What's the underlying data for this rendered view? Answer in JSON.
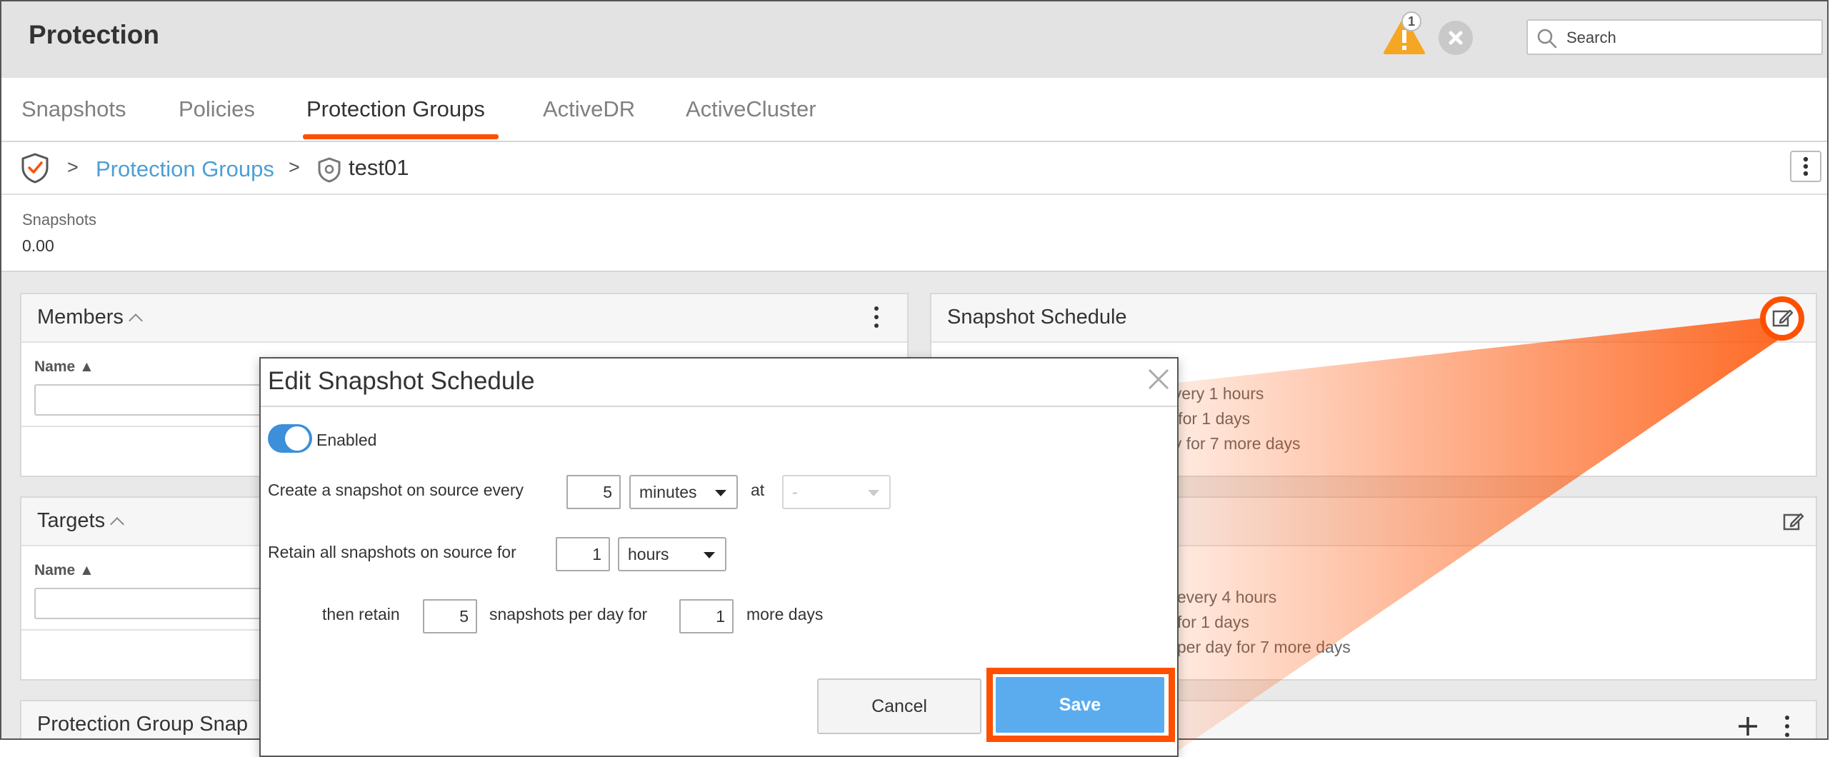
{
  "header": {
    "title": "Protection",
    "alert_count": "1",
    "search_placeholder": "Search"
  },
  "tabs": [
    {
      "label": "Snapshots"
    },
    {
      "label": "Policies"
    },
    {
      "label": "Protection Groups",
      "active": true
    },
    {
      "label": "ActiveDR"
    },
    {
      "label": "ActiveCluster"
    }
  ],
  "breadcrumb": {
    "separator": ">",
    "parent": "Protection Groups",
    "current": "test01"
  },
  "stats": {
    "label": "Snapshots",
    "value": "0.00"
  },
  "members_panel": {
    "title": "Members",
    "column": "Name"
  },
  "targets_panel": {
    "title": "Targets",
    "column": "Name"
  },
  "pg_snapshots_panel": {
    "title": "Protection Group Snap"
  },
  "snapshot_schedule_panel": {
    "title": "Snapshot Schedule",
    "lines": [
      "every 1 hours",
      "e for 1 days",
      "ay for 7 more days"
    ]
  },
  "replication_schedule_panel": {
    "lines": [
      "s every 4 hours",
      "s for 1 days",
      "s per day for 7 more days"
    ]
  },
  "modal": {
    "title": "Edit Snapshot Schedule",
    "enabled_label": "Enabled",
    "create_prefix": "Create a snapshot on source every",
    "create_value": "5",
    "create_unit": "minutes",
    "at_label": "at",
    "at_value": "-",
    "retain_prefix": "Retain all snapshots on source for",
    "retain_value": "1",
    "retain_unit": "hours",
    "then_retain_label": "then retain",
    "then_retain_value": "5",
    "per_day_label": "snapshots per day for",
    "days_value": "1",
    "more_days_label": "more days",
    "cancel_label": "Cancel",
    "save_label": "Save"
  },
  "colors": {
    "accent": "#fe5000",
    "link": "#4c9fd6",
    "primary_button": "#5aacef",
    "toggle_on": "#3c8fd8",
    "warning": "#f5a623"
  }
}
